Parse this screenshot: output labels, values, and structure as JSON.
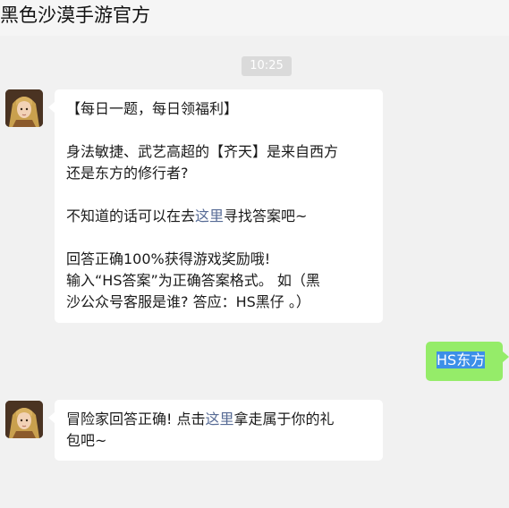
{
  "header": {
    "title": "黑色沙漠手游官方"
  },
  "timestamp": "10:25",
  "messages": {
    "first": {
      "line1": "【每日一题，每日领福利】",
      "line2": "身法敏捷、武艺高超的【齐天】是来自西方",
      "line3": "还是东方的修行者?",
      "line4_pre": "不知道的话可以在去",
      "line4_link": "这里",
      "line4_post": "寻找答案吧~",
      "line5": "回答正确100%获得游戏奖励哦!",
      "line6": "输入“HS答案”为正确答案格式。 如（黑",
      "line7": "沙公众号客服是谁? 答应：HS黑仔 。）"
    },
    "reply": {
      "text": "HS东方"
    },
    "second": {
      "line1_pre": "冒险家回答正确! 点击",
      "line1_link": "这里",
      "line1_post": "拿走属于你的礼",
      "line2": "包吧~"
    }
  },
  "colors": {
    "background": "#f1f1f1",
    "bubble_incoming": "#ffffff",
    "bubble_outgoing": "#95ec69",
    "link": "#576b95",
    "selection": "#3c8fe8"
  },
  "icons": {
    "avatar": "game-character-avatar"
  }
}
